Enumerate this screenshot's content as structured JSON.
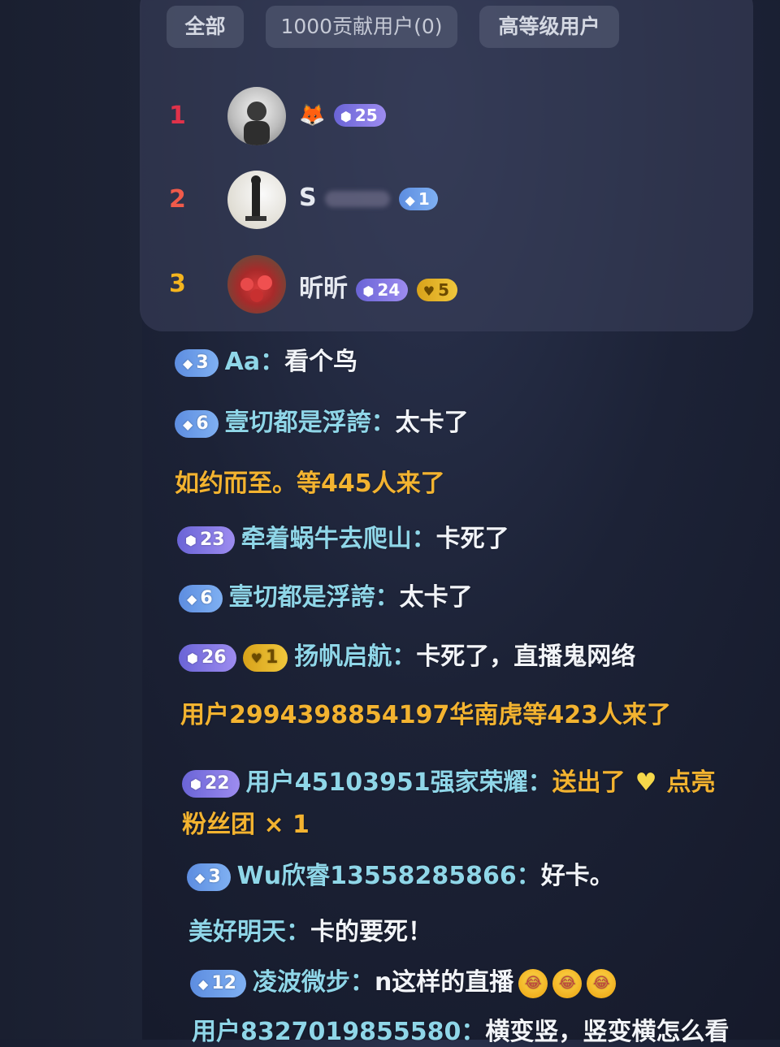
{
  "tabs": [
    "全部",
    "1000贡献用户(0)",
    "高等级用户"
  ],
  "ranking": [
    {
      "rank": "1",
      "name": "",
      "badge": "25",
      "badge_type": "purple",
      "rank_color": "#e0324a"
    },
    {
      "rank": "2",
      "name": "S",
      "badge": "1",
      "badge_type": "blue",
      "rank_color": "#f05a4a"
    },
    {
      "rank": "3",
      "name": "昕昕",
      "badge": "24",
      "badge_type": "purple",
      "extra_badge": "5",
      "rank_color": "#f5b51e"
    }
  ],
  "chat": [
    {
      "badge": "3",
      "badge_type": "blue",
      "name": "Aa：",
      "msg": "看个鸟"
    },
    {
      "badge": "6",
      "badge_type": "blue",
      "name": "壹切都是浮誇：",
      "msg": "太卡了"
    },
    {
      "system": "如约而至。等445人来了"
    },
    {
      "badge": "23",
      "badge_type": "purple",
      "name": "牵着蜗牛去爬山：",
      "msg": "卡死了"
    },
    {
      "badge": "6",
      "badge_type": "blue",
      "name": "壹切都是浮誇：",
      "msg": "太卡了"
    },
    {
      "badge": "26",
      "badge_type": "purple",
      "extra_badge": "1",
      "name": "扬帆启航：",
      "msg": "卡死了，直播鬼网络"
    },
    {
      "system": "用户2994398854197华南虎等423人来了"
    },
    {
      "badge": "22",
      "badge_type": "purple",
      "name": "用户45103951强家荣耀：",
      "gift_prefix": "送出了",
      "gift_suffix": "点亮",
      "gift_line2": "粉丝团 × 1"
    },
    {
      "badge": "3",
      "badge_type": "blue",
      "name": "Wu欣睿13558285866：",
      "msg": "好卡。"
    },
    {
      "name": "美好明天：",
      "msg": "卡的要死！"
    },
    {
      "badge": "12",
      "badge_type": "blue",
      "name": "凌波微步：",
      "msg": "n这样的直播"
    },
    {
      "name": "用户8327019855580：",
      "msg": "横变竖，竖变横怎么看"
    }
  ],
  "icons": {
    "diamond": "diamond-icon",
    "gem": "gem-icon",
    "heart": "heart-icon",
    "laugh_cry": "laugh-cry-emoji"
  }
}
